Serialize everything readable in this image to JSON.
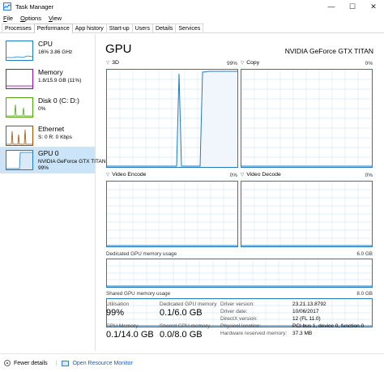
{
  "window": {
    "title": "Task Manager",
    "buttons": {
      "minimize": "—",
      "maximize": "☐",
      "close": "✕"
    }
  },
  "menu": {
    "file": {
      "accel": "F",
      "rest": "ile"
    },
    "options": {
      "accel": "O",
      "rest": "ptions"
    },
    "view": {
      "accel": "V",
      "rest": "iew"
    }
  },
  "tabs": [
    "Processes",
    "Performance",
    "App history",
    "Start-up",
    "Users",
    "Details",
    "Services"
  ],
  "active_tab": "Performance",
  "sidebar": {
    "items": [
      {
        "name": "CPU",
        "sub": "16% 3.86 GHz",
        "sub2": "",
        "color": "#1f7bc2"
      },
      {
        "name": "Memory",
        "sub": "1.8/15.9 GB (11%)",
        "sub2": "",
        "color": "#8b12ae"
      },
      {
        "name": "Disk 0 (C: D:)",
        "sub": "0%",
        "sub2": "",
        "color": "#4da60c"
      },
      {
        "name": "Ethernet",
        "sub": "S: 0 R: 0 Kbps",
        "sub2": "",
        "color": "#a74f01"
      },
      {
        "name": "GPU 0",
        "sub": "NVIDIA GeForce GTX TITAN",
        "sub2": "99%",
        "color": "#1f7bc2"
      }
    ]
  },
  "main": {
    "title": "GPU",
    "model": "NVIDIA GeForce GTX TITAN",
    "graphs": [
      {
        "label": "3D",
        "pct": "99%"
      },
      {
        "label": "Copy",
        "pct": "0%"
      },
      {
        "label": "Video Encode",
        "pct": "0%"
      },
      {
        "label": "Video Decode",
        "pct": "0%"
      }
    ],
    "dedicated": {
      "label": "Dedicated GPU memory usage",
      "max": "6.0 GB"
    },
    "shared": {
      "label": "Shared GPU memory usage",
      "max": "8.0 GB"
    },
    "stats": {
      "utilisation_label": "Utilisation",
      "utilisation": "99%",
      "dedicated_label": "Dedicated GPU memory",
      "dedicated": "0.1/6.0 GB",
      "gpu_memory_label": "GPU Memory",
      "gpu_memory": "0.1/14.0 GB",
      "shared_label": "Shared GPU memory",
      "shared": "0.0/8.0 GB"
    },
    "info": [
      {
        "key": "Driver version:",
        "value": "23.21.13.8792"
      },
      {
        "key": "Driver date:",
        "value": "10/06/2017"
      },
      {
        "key": "DirectX version:",
        "value": "12 (FL 11.0)"
      },
      {
        "key": "Physical location:",
        "value": "PCI bus 1, device 0, function 0"
      },
      {
        "key": "Hardware reserved memory:",
        "value": "37.3 MB"
      }
    ]
  },
  "footer": {
    "fewer_details": "Fewer details",
    "open_monitor": "Open Resource Monitor"
  },
  "colors": {
    "gpu_line": "#1f7bc2",
    "grid": "#d9eaf7",
    "fill": "#f1f6fc",
    "selected": "#cce4f7"
  }
}
